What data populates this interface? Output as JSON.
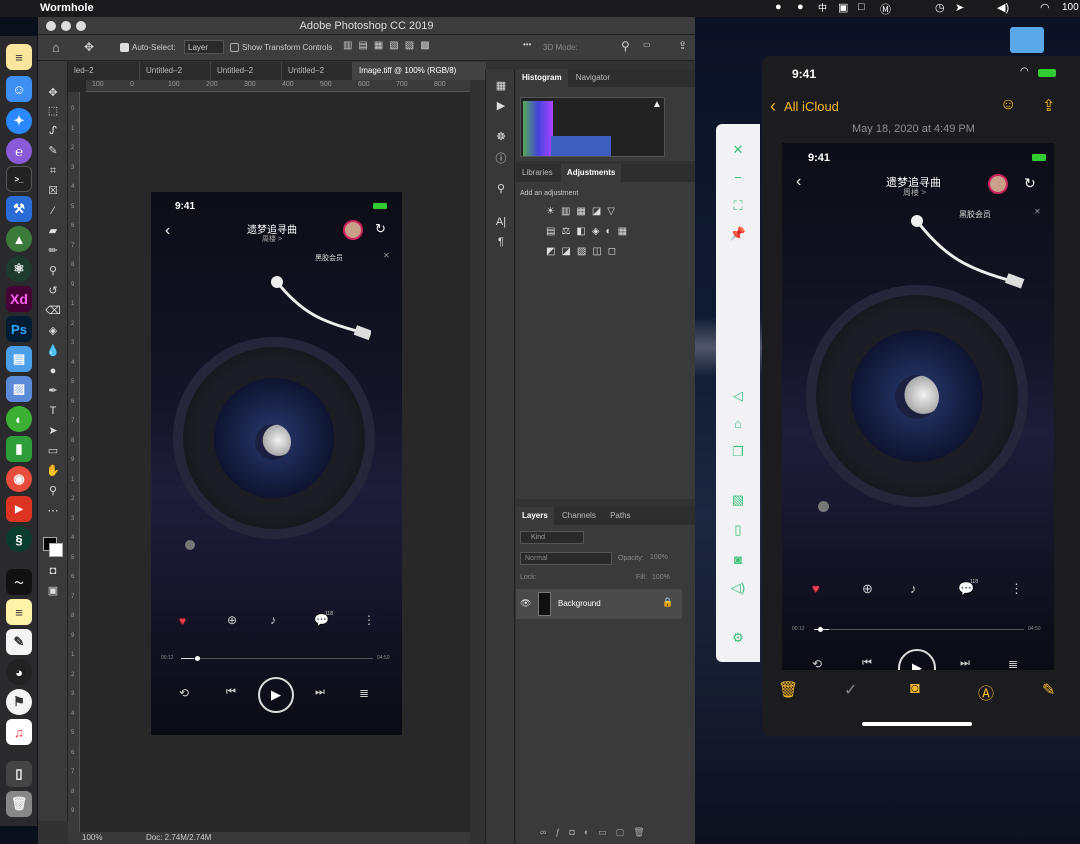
{
  "menubar": {
    "app": "Wormhole",
    "battery": "100"
  },
  "photoshop": {
    "window_title": "Adobe Photoshop CC 2019",
    "options": {
      "auto_select": "Auto-Select:",
      "layer_select": "Layer",
      "transform": "Show Transform Controls",
      "mode3d": "3D Mode:"
    },
    "tabs": [
      "led–2",
      "Untitled–2",
      "Untitled–2",
      "Untitled–2",
      "Image.tiff @ 100% (RGB/8)"
    ],
    "ruler_h": [
      "100",
      "0",
      "100",
      "200",
      "300",
      "400",
      "500",
      "600",
      "700",
      "800"
    ],
    "ruler_v": [
      "0",
      "1",
      "2",
      "3",
      "4",
      "5",
      "6",
      "7",
      "8",
      "9",
      "1",
      "2",
      "3",
      "4",
      "5",
      "6",
      "7",
      "8",
      "9",
      "1",
      "2",
      "3",
      "4",
      "5",
      "6",
      "7",
      "8",
      "9",
      "1",
      "2",
      "3",
      "4",
      "5",
      "6",
      "7",
      "8",
      "9"
    ],
    "status_zoom": "100%",
    "status_doc": "Doc: 2.74M/2.74M",
    "histogram_tab": "Histogram",
    "navigator_tab": "Navigator",
    "libraries_tab": "Libraries",
    "adjustments_tab": "Adjustments",
    "add_adjustment": "Add an adjustment",
    "layers_tab": "Layers",
    "channels_tab": "Channels",
    "paths_tab": "Paths",
    "kind": "Kind",
    "blend": "Normal",
    "opacity_label": "Opacity:",
    "opacity": "100%",
    "lock_label": "Lock:",
    "fill_label": "Fill:",
    "fill": "100%",
    "layer_name": "Background"
  },
  "player": {
    "time": "9:41",
    "song": "遗梦追寻曲",
    "artist": "周楼 >",
    "vip": "黑胶会员",
    "elapsed": "00:12",
    "total": "04:50",
    "comment_count": "118",
    "progress": 0.07
  },
  "notes": {
    "time": "9:41",
    "back": "All iCloud",
    "date": "May 18, 2020 at 4:49 PM"
  },
  "colors": {
    "accent_green": "#3bbf7a",
    "notes_yellow": "#f5b72a",
    "heart": "#ff3b4b"
  }
}
